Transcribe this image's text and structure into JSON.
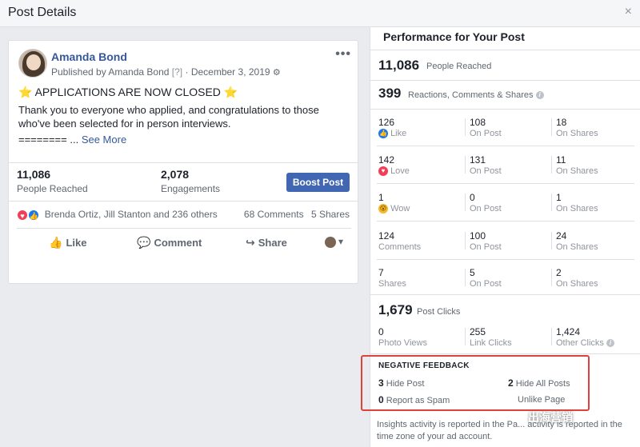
{
  "dialog": {
    "title": "Post Details",
    "close": "×"
  },
  "post": {
    "author": "Amanda Bond",
    "published_prefix": "Published by Amanda Bond",
    "help_tag": "[?]",
    "date_sep": "·",
    "date": "December 3, 2019",
    "more": "•••",
    "line1_text": "APPLICATIONS ARE NOW CLOSED",
    "star": "⭐",
    "body": "Thank you to everyone who applied, and congratulations to those who've been selected for in person interviews.",
    "line3_prefix": "======== ...",
    "see_more": "See More"
  },
  "post_stats": {
    "reached_num": "11,086",
    "reached_label": "People Reached",
    "engagements_num": "2,078",
    "engagements_label": "Engagements",
    "boost_label": "Boost Post"
  },
  "reactions": {
    "names": "Brenda Ortiz, Jill Stanton and 236 others",
    "comments": "68 Comments",
    "shares": "5 Shares"
  },
  "actions": {
    "like": "Like",
    "comment": "Comment",
    "share": "Share"
  },
  "performance": {
    "title": "Performance for Your Post",
    "people_reached_num": "11,086",
    "people_reached_label": "People Reached",
    "rcs_num": "399",
    "rcs_label": "Reactions, Comments & Shares",
    "rows": [
      {
        "total": "126",
        "label": "Like",
        "on_post": "108",
        "on_post_label": "On Post",
        "on_shares": "18",
        "on_shares_label": "On Shares"
      },
      {
        "total": "142",
        "label": "Love",
        "on_post": "131",
        "on_post_label": "On Post",
        "on_shares": "11",
        "on_shares_label": "On Shares"
      },
      {
        "total": "1",
        "label": "Wow",
        "on_post": "0",
        "on_post_label": "On Post",
        "on_shares": "1",
        "on_shares_label": "On Shares"
      },
      {
        "total": "124",
        "label": "Comments",
        "on_post": "100",
        "on_post_label": "On Post",
        "on_shares": "24",
        "on_shares_label": "On Shares"
      },
      {
        "total": "7",
        "label": "Shares",
        "on_post": "5",
        "on_post_label": "On Post",
        "on_shares": "2",
        "on_shares_label": "On Shares"
      }
    ],
    "post_clicks_num": "1,679",
    "post_clicks_label": "Post Clicks",
    "clicks": [
      {
        "num": "0",
        "label": "Photo Views"
      },
      {
        "num": "255",
        "label": "Link Clicks"
      },
      {
        "num": "1,424",
        "label": "Other Clicks"
      }
    ],
    "negative": {
      "title": "NEGATIVE FEEDBACK",
      "hide_post_num": "3",
      "hide_post_label": "Hide Post",
      "hide_all_num": "2",
      "hide_all_label": "Hide All Posts",
      "spam_num": "0",
      "spam_label": "Report as Spam",
      "unlike_label": "Unlike Page"
    },
    "footer": "Insights activity is reported in the Pa... activity is reported in the time zone of your ad account."
  },
  "watermark": "出海营销",
  "colors": {
    "brand_blue": "#4267b2",
    "link_blue": "#365899",
    "highlight_red": "#e0413a"
  }
}
